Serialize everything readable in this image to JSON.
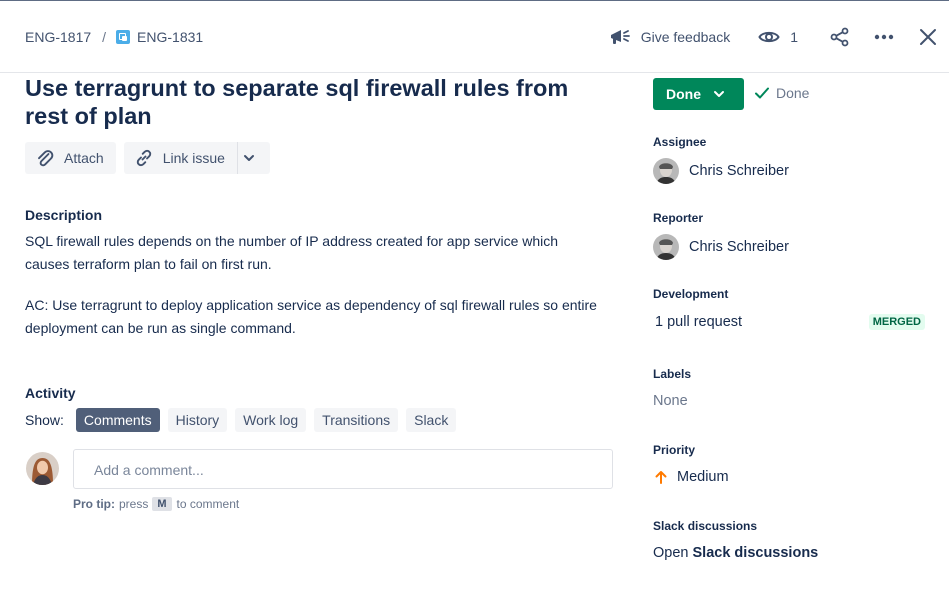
{
  "breadcrumbs": {
    "parent": "ENG-1817",
    "separator": "/",
    "current": "ENG-1831"
  },
  "header": {
    "feedback_label": "Give feedback",
    "watch_count": "1"
  },
  "issue": {
    "title": "Use terragrunt to separate sql firewall rules from rest of plan",
    "toolbar": {
      "attach_label": "Attach",
      "link_label": "Link issue"
    },
    "description": {
      "label": "Description",
      "paragraphs": [
        "SQL firewall rules depends on the number of IP address created for app service which causes terraform plan to fail on first run.",
        "AC: Use terragrunt to deploy application service as dependency of sql firewall rules so entire deployment can be run as single command."
      ]
    }
  },
  "activity": {
    "label": "Activity",
    "show_label": "Show:",
    "filters": [
      "Comments",
      "History",
      "Work log",
      "Transitions",
      "Slack"
    ],
    "active_filter": "Comments",
    "comment_placeholder": "Add a comment...",
    "protip": {
      "label": "Pro tip:",
      "before": "press",
      "key": "M",
      "after": "to comment"
    }
  },
  "sidebar": {
    "status_label": "Done",
    "resolution_label": "Done",
    "assignee": {
      "label": "Assignee",
      "name": "Chris Schreiber"
    },
    "reporter": {
      "label": "Reporter",
      "name": "Chris Schreiber"
    },
    "development": {
      "label": "Development",
      "value": "1 pull request",
      "badge": "MERGED"
    },
    "labels": {
      "label": "Labels",
      "value": "None"
    },
    "priority": {
      "label": "Priority",
      "value": "Medium"
    },
    "slack": {
      "label": "Slack discussions",
      "prefix": "Open",
      "link": "Slack discussions"
    }
  },
  "colors": {
    "status_green": "#00875a",
    "active_filter": "#505f79",
    "priority_orange": "#ff7a00",
    "merged_badge": "#006644"
  },
  "icons": [
    "megaphone-icon",
    "eye-icon",
    "share-icon",
    "more-icon",
    "close-icon",
    "paperclip-icon",
    "link-icon",
    "chevron-down-icon",
    "check-icon",
    "arrow-up-icon",
    "subtask-icon"
  ]
}
